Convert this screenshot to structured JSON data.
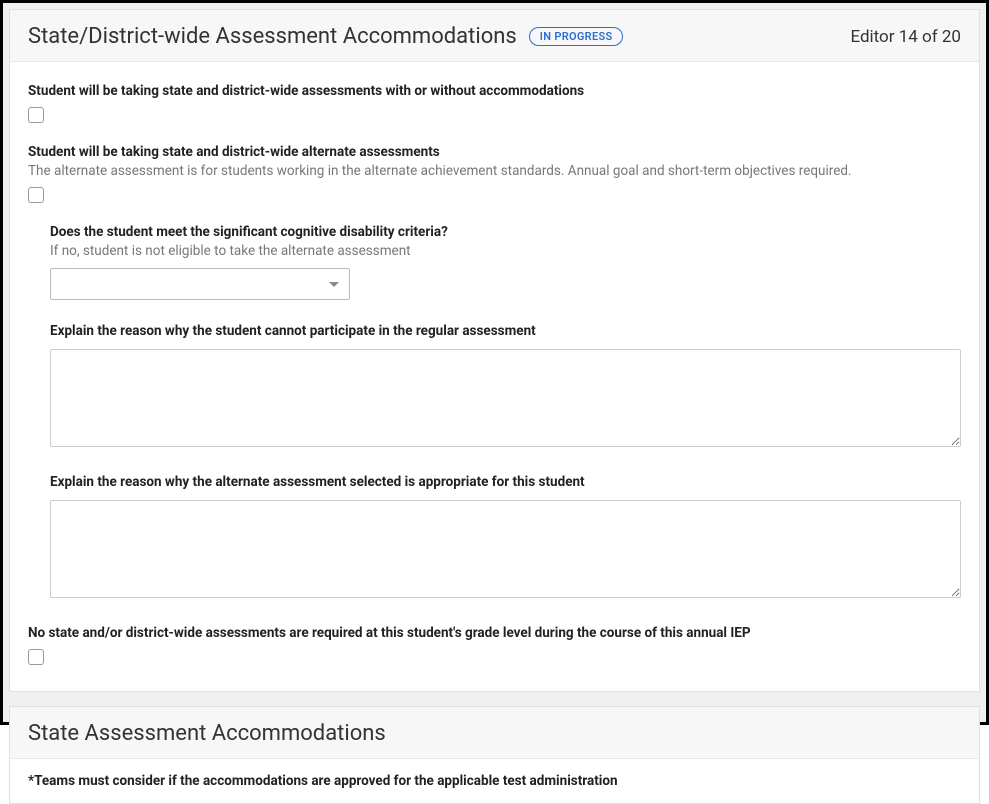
{
  "header": {
    "title": "State/District-wide Assessment Accommodations",
    "status_badge": "IN PROGRESS",
    "editor_count": "Editor 14 of 20"
  },
  "fields": {
    "f1": {
      "label": "Student will be taking state and district-wide assessments with or without accommodations"
    },
    "f2": {
      "label": "Student will be taking state and district-wide alternate assessments",
      "hint": "The alternate assessment is for students working in the alternate achievement standards. Annual goal and short-term objectives required."
    },
    "f3": {
      "label": "Does the student meet the significant cognitive disability criteria?",
      "hint": "If no, student is not eligible to take the alternate assessment"
    },
    "f4": {
      "label": "Explain the reason why the student cannot participate in the regular assessment"
    },
    "f5": {
      "label": "Explain the reason why the alternate assessment selected is appropriate for this student"
    },
    "f6": {
      "label": "No state and/or district-wide assessments are required at this student's grade level during the course of this annual IEP"
    }
  },
  "section2": {
    "title": "State Assessment Accommodations",
    "note": "*Teams must consider if the accommodations are approved for the applicable test administration"
  }
}
